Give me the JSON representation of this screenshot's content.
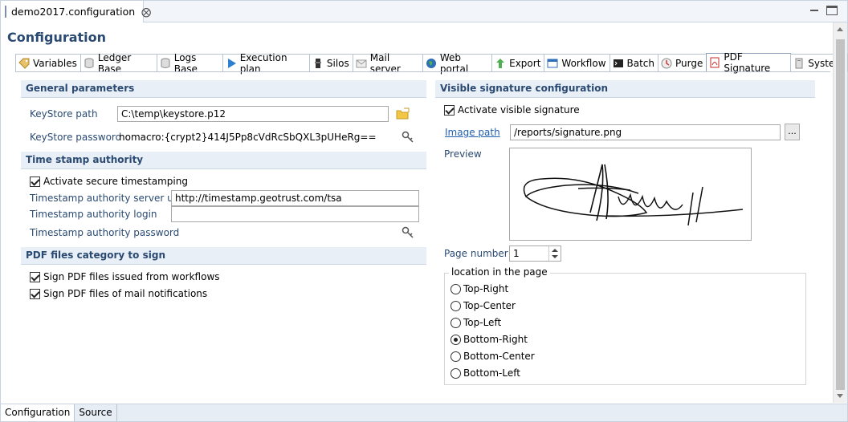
{
  "editor": {
    "tab_title": "demo2017.configuration",
    "close_glyph": "⨂"
  },
  "page": {
    "title": "Configuration"
  },
  "tabs": [
    {
      "label": "Variables",
      "icon": "tag-icon"
    },
    {
      "label": "Ledger Base",
      "icon": "database-icon"
    },
    {
      "label": "Logs Base",
      "icon": "database-icon"
    },
    {
      "label": "Execution plan",
      "icon": "play-icon"
    },
    {
      "label": "Silos",
      "icon": "silo-icon"
    },
    {
      "label": "Mail server",
      "icon": "mail-icon"
    },
    {
      "label": "Web portal",
      "icon": "globe-icon"
    },
    {
      "label": "Export",
      "icon": "export-icon"
    },
    {
      "label": "Workflow",
      "icon": "workflow-icon"
    },
    {
      "label": "Batch",
      "icon": "terminal-icon"
    },
    {
      "label": "Purge",
      "icon": "purge-icon"
    },
    {
      "label": "PDF Signature",
      "icon": "pdf-icon",
      "active": true
    },
    {
      "label": "System",
      "icon": "system-icon"
    }
  ],
  "general": {
    "heading": "General parameters",
    "keystore_path_label": "KeyStore path",
    "keystore_path_value": "C:\\temp\\keystore.p12",
    "keystore_password_label": "KeyStore password",
    "keystore_password_value": "nomacro:{crypt2}414J5Pp8cVdRcSbQXL3pUHeRg=="
  },
  "tsa": {
    "heading": "Time stamp authority",
    "activate_label": "Activate secure timestamping",
    "activate_checked": true,
    "url_label": "Timestamp authority server url",
    "url_value": "http://timestamp.geotrust.com/tsa",
    "login_label": "Timestamp authority login",
    "login_value": "",
    "password_label": "Timestamp authority password"
  },
  "category": {
    "heading": "PDF files category to sign",
    "workflows_label": "Sign PDF files issued from workflows",
    "workflows_checked": true,
    "mail_label": "Sign PDF files of mail notifications",
    "mail_checked": true
  },
  "visible": {
    "heading": "Visible signature configuration",
    "activate_label": "Activate visible signature",
    "activate_checked": true,
    "image_path_label": "Image path",
    "image_path_value": "/reports/signature.png",
    "browse_label": "...",
    "preview_label": "Preview",
    "page_number_label": "Page number",
    "page_number_value": "1",
    "location_title": "location in the page",
    "locations": [
      {
        "label": "Top-Right",
        "selected": false
      },
      {
        "label": "Top-Center",
        "selected": false
      },
      {
        "label": "Top-Left",
        "selected": false
      },
      {
        "label": "Bottom-Right",
        "selected": true
      },
      {
        "label": "Bottom-Center",
        "selected": false
      },
      {
        "label": "Bottom-Left",
        "selected": false
      }
    ]
  },
  "bottom_tabs": [
    {
      "label": "Configuration",
      "active": true
    },
    {
      "label": "Source",
      "active": false
    }
  ],
  "colors": {
    "heading_text": "#2a4a72",
    "section_bg": "#e9eff7",
    "link": "#1f5fae"
  }
}
